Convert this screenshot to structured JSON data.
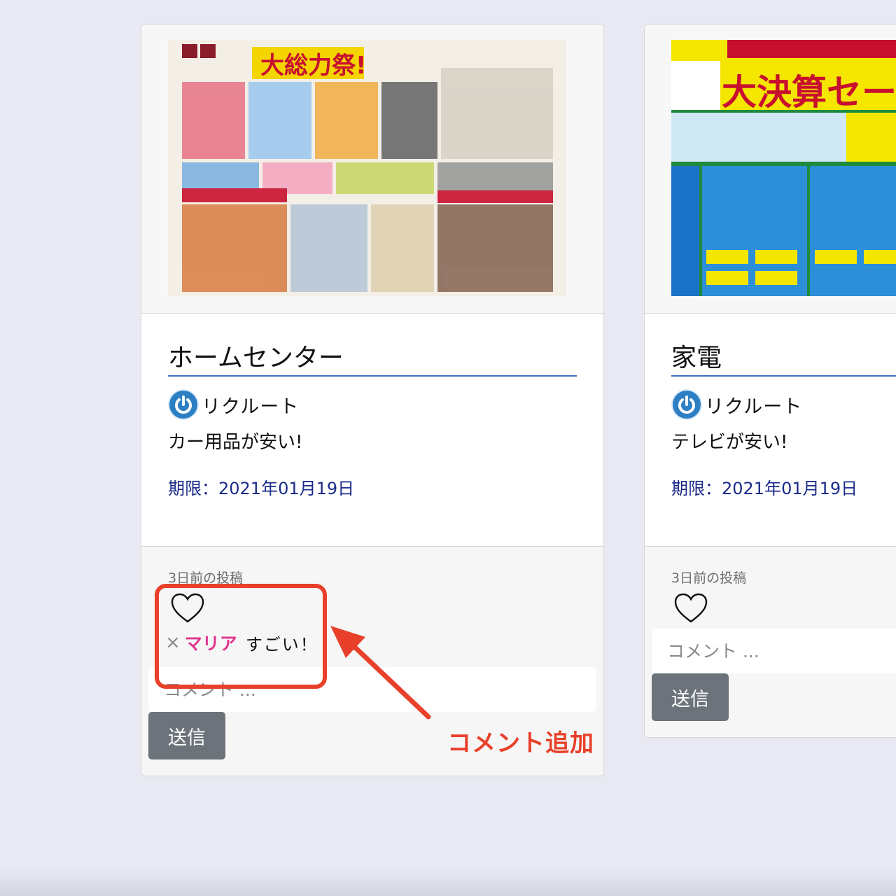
{
  "cards": [
    {
      "image_alt": "ホームセンター チラシ",
      "flyer_headline": "大総力祭!",
      "title": "ホームセンター",
      "author": "リクルート",
      "description": "カー用品が安い!",
      "deadline": "期限：2021年01月19日",
      "posted": "3日前の投稿",
      "liked": false,
      "comments": [
        {
          "delete_icon": "×",
          "user": "マリア",
          "text": "すごい！"
        }
      ],
      "comment_placeholder": "コメント ...",
      "send_label": "送信"
    },
    {
      "image_alt": "家電 チラシ",
      "flyer_headline": "大決算セール",
      "title": "家電",
      "author": "リクルート",
      "description": "テレビが安い!",
      "deadline": "期限：2021年01月19日",
      "posted": "3日前の投稿",
      "liked": false,
      "comments": [],
      "comment_placeholder": "コメント ...",
      "send_label": "送信"
    }
  ],
  "annotation": {
    "label": "コメント追加",
    "color": "#e8402a"
  },
  "colors": {
    "title_underline": "#3f6fc3",
    "deadline_text": "#1b2b8a",
    "comment_user": "#e0358d",
    "send_button": "#6c737a",
    "page_background": "#e9e9f3"
  },
  "icons": {
    "like": "heart-outline-icon",
    "avatar": "power-icon",
    "delete_comment": "close-icon"
  }
}
